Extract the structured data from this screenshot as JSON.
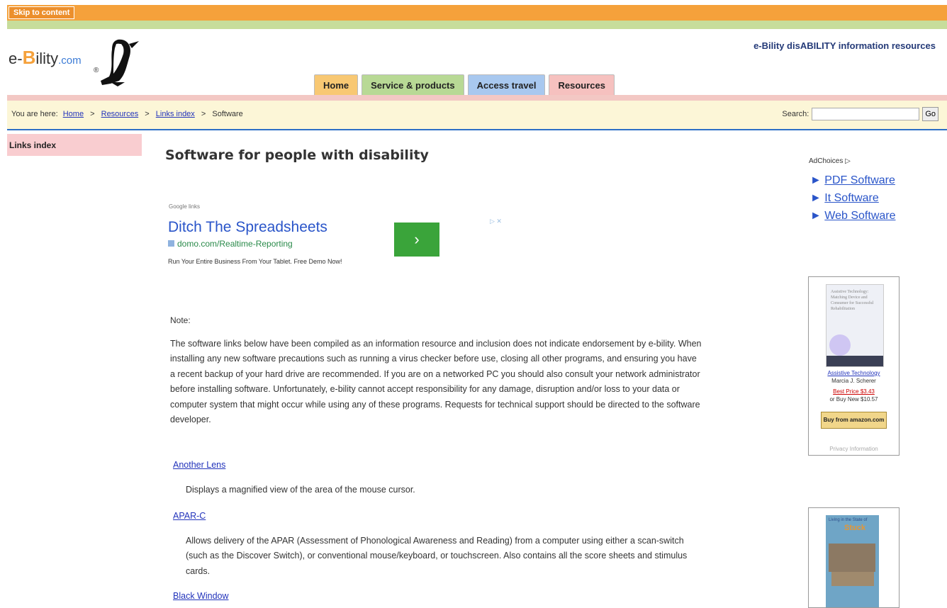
{
  "skip_link": "Skip to content",
  "logo": {
    "prefix": "e-",
    "b": "B",
    "suffix": "ility",
    "dot_com": ".com",
    "reg": "®"
  },
  "tagline": "e-Bility disABILITY information resources",
  "tabs": [
    "Home",
    "Service & products",
    "Access travel",
    "Resources"
  ],
  "breadcrumb": {
    "lead": "You are here:",
    "items": [
      "Home",
      "Resources",
      "Links index"
    ],
    "current": "Software",
    "sep": ">"
  },
  "search": {
    "label": "Search:",
    "value": "",
    "button": "Go"
  },
  "sidebar": {
    "title": "Links index"
  },
  "page_title": "Software for people with disability",
  "ad": {
    "label": "Google links",
    "title": "Ditch The Spreadsheets",
    "url": "domo.com/Realtime-Reporting",
    "desc": "Run Your Entire Business From Your Tablet. Free Demo Now!",
    "go": "›",
    "badge": "▷ ✕"
  },
  "note": {
    "heading": "Note:",
    "text": "The software links below have been compiled as an information resource and inclusion does not indicate endorsement by e-bility. When installing any new software precautions such as running a virus checker before use, closing all other programs, and ensuring you have a recent backup of your hard drive are recommended. If you are on a networked PC you should also consult your network administrator before installing software. Unfortunately, e-bility cannot accept responsibility for any damage, disruption and/or loss to your data or computer system that might occur while using any of these programs. Requests for technical support should be directed to the software developer."
  },
  "software": [
    {
      "name": "Another Lens",
      "desc": "Displays a magnified view of the area of the mouse cursor."
    },
    {
      "name": "APAR-C",
      "desc": "Allows delivery of the APAR (Assessment of Phonological Awareness and Reading) from a computer using either a scan-switch (such as the Discover Switch), or conventional mouse/keyboard, or touchscreen. Also contains all the score sheets and stimulus cards."
    },
    {
      "name": "Black Window",
      "desc": ""
    }
  ],
  "right": {
    "adchoices": "AdChoices ▷",
    "links": [
      "PDF Software",
      "It Software",
      "Web Software"
    ],
    "link_marker": "►"
  },
  "book1": {
    "cover_text": "Assistive Technology: Matching Device and Consumer for Successful Rehabilitation",
    "title": "Assistive Technology",
    "author": "Marcia J. Scherer",
    "best_price": "Best Price $3.43",
    "buy_new": "or Buy New $10.57",
    "amazon": "Buy from amazon.com",
    "privacy": "Privacy Information"
  },
  "book2": {
    "cover_text": "Living in the State of",
    "cover_word": "Stuck"
  }
}
